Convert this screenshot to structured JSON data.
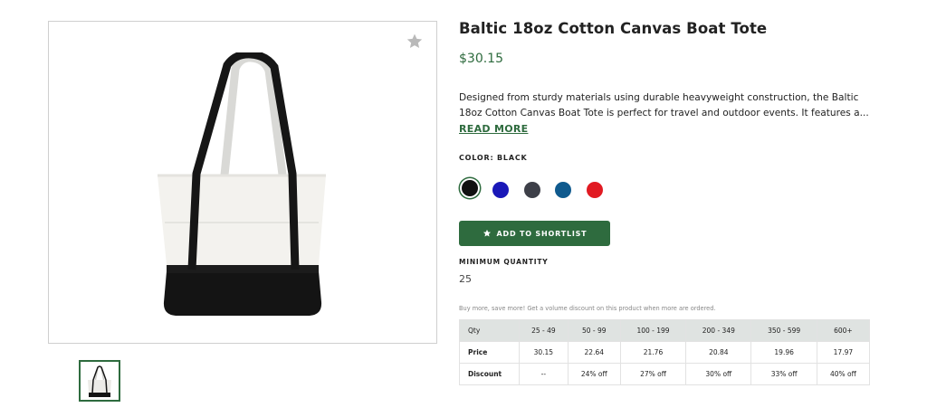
{
  "product": {
    "title": "Baltic 18oz Cotton Canvas Boat Tote",
    "price": "$30.15",
    "description_line1": "Designed from sturdy materials using durable heavyweight construction, the Baltic",
    "description_line2": "18oz Cotton Canvas Boat Tote is perfect for travel and outdoor events. It features a...",
    "read_more": "READ MORE"
  },
  "color": {
    "label": "COLOR: BLACK",
    "swatches": [
      {
        "name": "black",
        "hex": "#111111",
        "selected": true
      },
      {
        "name": "royal-blue",
        "hex": "#1a18b8",
        "selected": false
      },
      {
        "name": "charcoal",
        "hex": "#3d3f48",
        "selected": false
      },
      {
        "name": "navy-blue",
        "hex": "#0f5a8e",
        "selected": false
      },
      {
        "name": "red",
        "hex": "#e11a22",
        "selected": false
      }
    ]
  },
  "actions": {
    "shortlist_label": "ADD TO SHORTLIST"
  },
  "minimum": {
    "label": "MINIMUM QUANTITY",
    "value": "25"
  },
  "volume": {
    "note": "Buy more, save more! Get a volume discount on this product when more are ordered.",
    "headers": [
      "Qty",
      "25 - 49",
      "50 - 99",
      "100 - 199",
      "200 - 349",
      "350 - 599",
      "600+"
    ],
    "rows": [
      [
        "Price",
        "30.15",
        "22.64",
        "21.76",
        "20.84",
        "19.96",
        "17.97"
      ],
      [
        "Discount",
        "--",
        "24% off",
        "27% off",
        "30% off",
        "33% off",
        "40% off"
      ]
    ]
  },
  "colors": {
    "accent": "#2e6b3e",
    "table_header_bg": "#dfe3e1"
  },
  "icons": {
    "favorite": "star-icon",
    "shortlist": "star-icon"
  }
}
